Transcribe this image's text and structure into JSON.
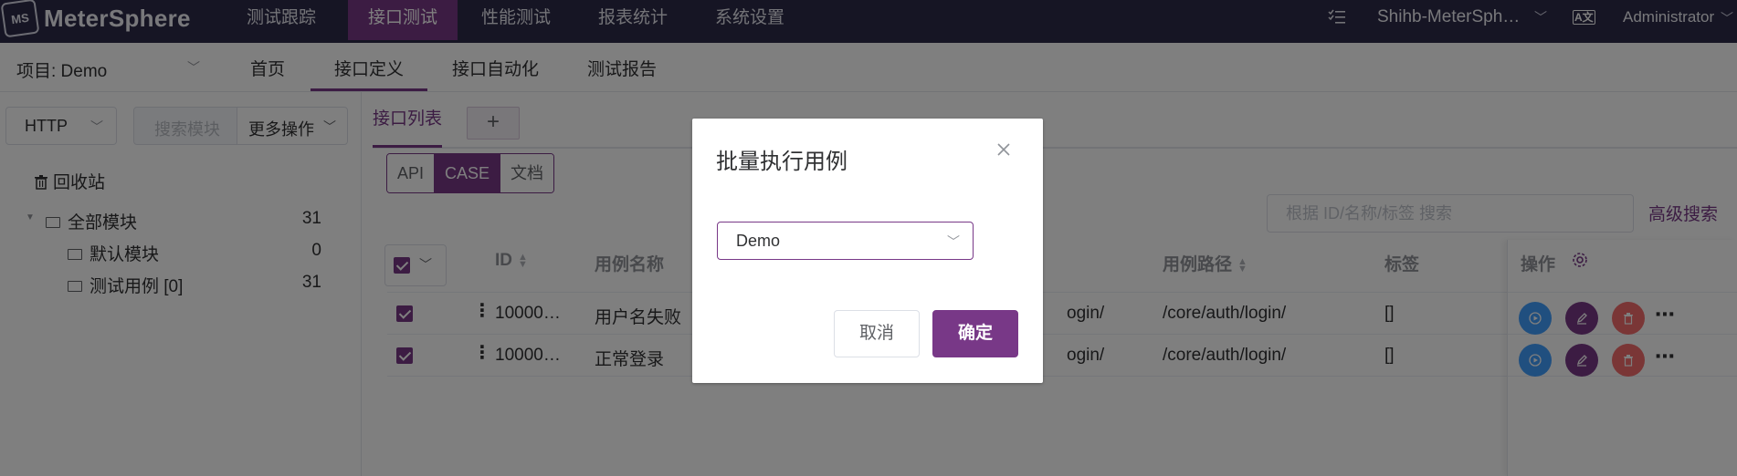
{
  "app": {
    "brand": "MeterSphere",
    "logo_mark": "MS"
  },
  "top_nav": [
    {
      "label": "测试跟踪",
      "active": false
    },
    {
      "label": "接口测试",
      "active": true
    },
    {
      "label": "性能测试",
      "active": false
    },
    {
      "label": "报表统计",
      "active": false
    },
    {
      "label": "系统设置",
      "active": false
    }
  ],
  "top_right": {
    "tasks_icon": "task-list-icon",
    "workspace": "Shihb-MeterSph…",
    "lang_icon": "A文",
    "user": "Administrator"
  },
  "sub_nav": {
    "project": "项目: Demo",
    "tabs": [
      "首页",
      "接口定义",
      "接口自动化",
      "测试报告"
    ],
    "active_tab": "接口定义"
  },
  "left_panel": {
    "protocol": "HTTP",
    "search_placeholder": "搜索模块",
    "more_ops": "更多操作",
    "recycle": "回收站",
    "tree": [
      {
        "label": "全部模块",
        "count": "31"
      },
      {
        "label": "默认模块",
        "count": "0"
      },
      {
        "label": "测试用例 [0]",
        "count": "31"
      }
    ]
  },
  "main": {
    "list_tab": "接口列表",
    "add_tab": "+",
    "modes": [
      "API",
      "CASE",
      "文档"
    ],
    "active_mode": "CASE",
    "search_placeholder": "根据 ID/名称/标签 搜索",
    "advanced_search": "高级搜索",
    "columns": {
      "id": "ID",
      "name": "用例名称",
      "path": "用例路径",
      "tags": "标签",
      "ops": "操作"
    },
    "rows": [
      {
        "id": "10000…",
        "name": "用户名失败",
        "api_path": "ogin/",
        "path": "/core/auth/login/",
        "tags": "[]",
        "checked": true
      },
      {
        "id": "10000…",
        "name": "正常登录",
        "api_path": "ogin/",
        "path": "/core/auth/login/",
        "tags": "[]",
        "checked": true
      }
    ]
  },
  "dialog": {
    "title": "批量执行用例",
    "select_value": "Demo",
    "cancel": "取消",
    "confirm": "确定"
  },
  "colors": {
    "primary": "#783887",
    "topbar": "#2c2a48",
    "run": "#409eff",
    "edit": "#783887",
    "delete": "#f56c6c"
  }
}
